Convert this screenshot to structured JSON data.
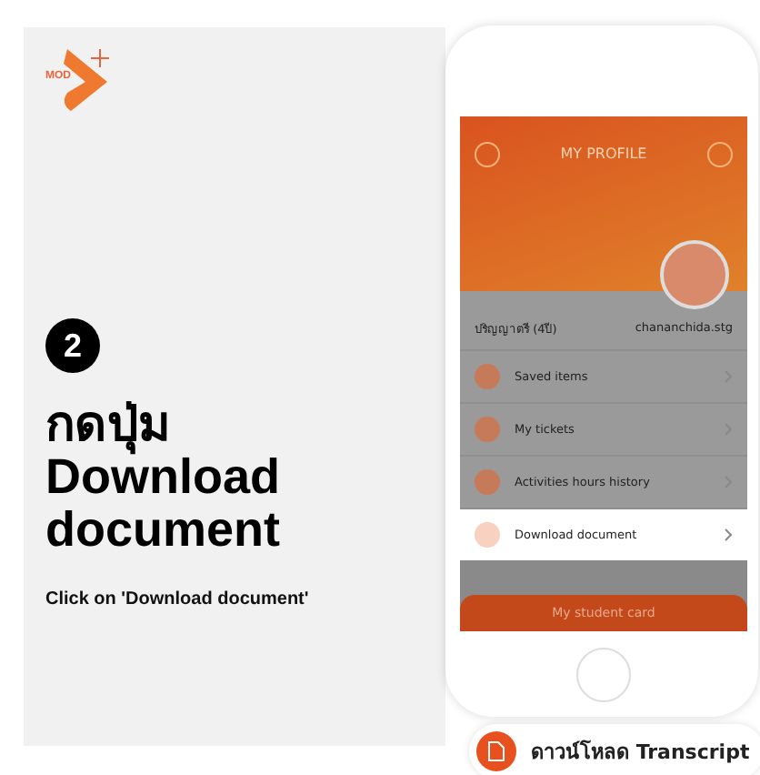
{
  "logo": {
    "text": "MOD"
  },
  "step": {
    "number": "2",
    "title_thai": "กดปุ่ม",
    "title": "Download document",
    "caption": "Click on 'Download document'"
  },
  "phone": {
    "header": {
      "title": "MY PROFILE"
    },
    "profile": {
      "education": "ปริญญาตรี (4ปี)",
      "username": "chananchida.stg"
    },
    "menu": [
      {
        "label": "Saved items",
        "selected": false
      },
      {
        "label": "My tickets",
        "selected": false
      },
      {
        "label": "Activities hours history",
        "selected": false
      },
      {
        "label": "Download document",
        "selected": true
      }
    ],
    "footer_button": "My student card"
  },
  "callout": {
    "label": "ดาวน์โหลด Transcript"
  }
}
